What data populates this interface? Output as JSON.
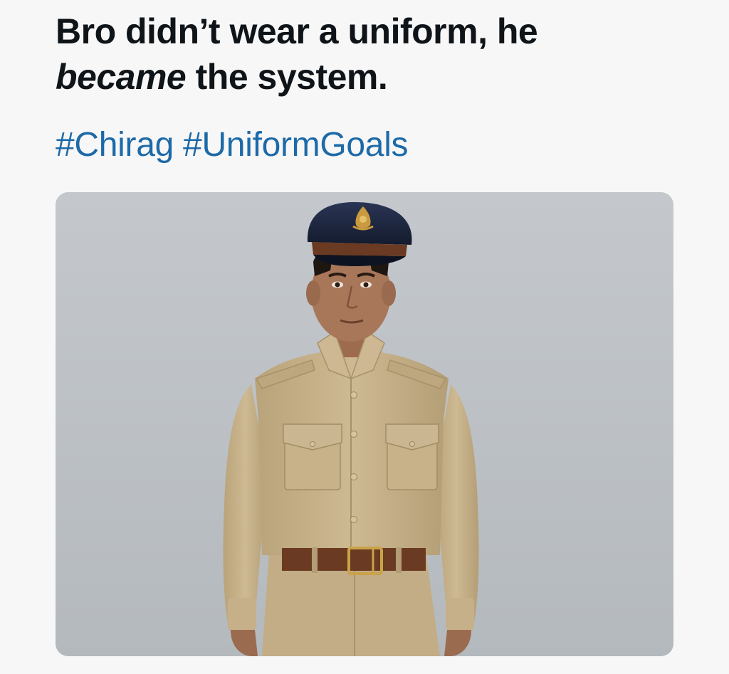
{
  "post": {
    "text_line1": "Bro didn’t wear a uniform, he",
    "text_line2_emphasis": "became",
    "text_line2_rest": " the system.",
    "hashtags": [
      "#Chirag",
      "#UniformGoals"
    ],
    "hashtag_separator": " "
  },
  "media": {
    "subject": "young man in khaki uniform with navy peaked cap",
    "colors": {
      "background": "#bfc4c8",
      "uniform": "#c8b48c",
      "cap": "#1c2640",
      "belt": "#6b3a22",
      "skin": "#a8775a",
      "hashtag": "#1d6aa8"
    }
  }
}
